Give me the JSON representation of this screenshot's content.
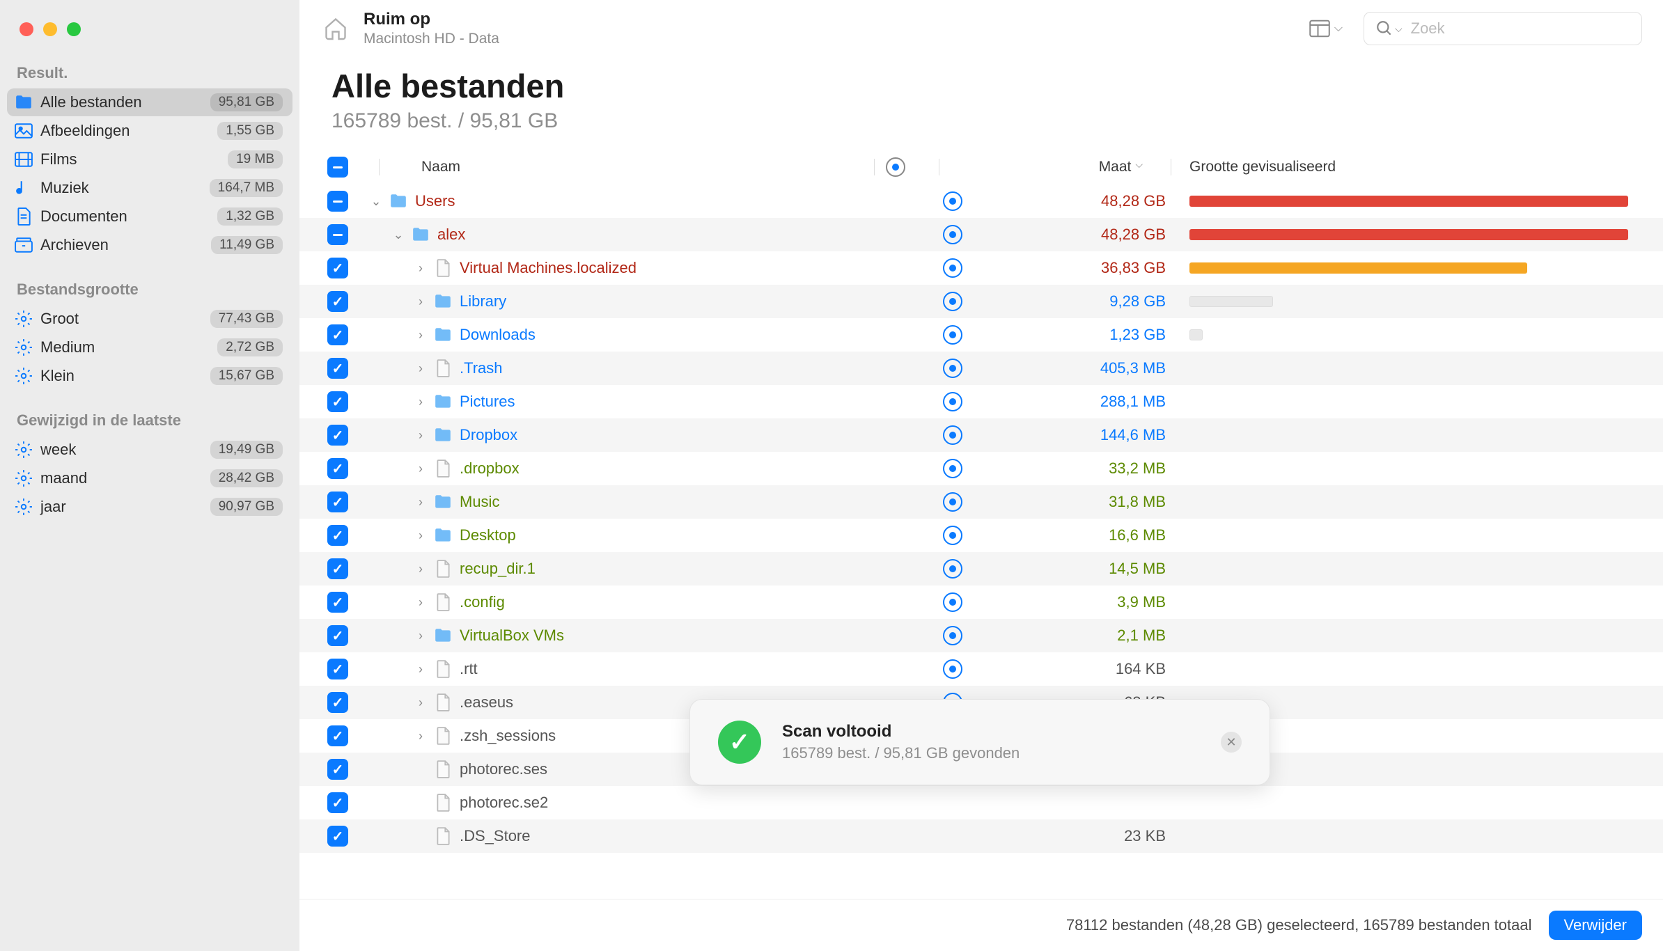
{
  "traffic": {
    "red": "#ff5f57",
    "yellow": "#febc2e",
    "green": "#28c840"
  },
  "topbar": {
    "title": "Ruim op",
    "subtitle": "Macintosh HD - Data",
    "search_placeholder": "Zoek"
  },
  "heading": {
    "title": "Alle bestanden",
    "subtitle": "165789 best. / 95,81 GB"
  },
  "columns": {
    "name": "Naam",
    "size": "Maat",
    "visual": "Grootte gevisualiseerd"
  },
  "sidebar": {
    "sections": [
      {
        "title": "Result.",
        "items": [
          {
            "icon": "folder",
            "color": "#0a7aff",
            "label": "Alle bestanden",
            "badge": "95,81 GB",
            "active": true
          },
          {
            "icon": "image",
            "color": "#0a7aff",
            "label": "Afbeeldingen",
            "badge": "1,55 GB"
          },
          {
            "icon": "film",
            "color": "#0a7aff",
            "label": "Films",
            "badge": "19 MB"
          },
          {
            "icon": "music",
            "color": "#0a7aff",
            "label": "Muziek",
            "badge": "164,7 MB"
          },
          {
            "icon": "doc",
            "color": "#0a7aff",
            "label": "Documenten",
            "badge": "1,32 GB"
          },
          {
            "icon": "archive",
            "color": "#0a7aff",
            "label": "Archieven",
            "badge": "11,49 GB"
          }
        ]
      },
      {
        "title": "Bestandsgrootte",
        "items": [
          {
            "icon": "gear",
            "color": "#0a7aff",
            "label": "Groot",
            "badge": "77,43 GB"
          },
          {
            "icon": "gear",
            "color": "#0a7aff",
            "label": "Medium",
            "badge": "2,72 GB"
          },
          {
            "icon": "gear",
            "color": "#0a7aff",
            "label": "Klein",
            "badge": "15,67 GB"
          }
        ]
      },
      {
        "title": "Gewijzigd in de laatste",
        "items": [
          {
            "icon": "gear",
            "color": "#0a7aff",
            "label": "week",
            "badge": "19,49 GB"
          },
          {
            "icon": "gear",
            "color": "#0a7aff",
            "label": "maand",
            "badge": "28,42 GB"
          },
          {
            "icon": "gear",
            "color": "#0a7aff",
            "label": "jaar",
            "badge": "90,97 GB"
          }
        ]
      }
    ]
  },
  "rows": [
    {
      "depth": 0,
      "chk": "partial",
      "expand": "down",
      "type": "folder",
      "name": "Users",
      "color": "#b22817",
      "target": true,
      "size": "48,28 GB",
      "sizeColor": "#b22817",
      "bar": 100,
      "barColor": "#e14438"
    },
    {
      "depth": 1,
      "chk": "partial",
      "expand": "down",
      "type": "folder",
      "name": "alex",
      "color": "#b22817",
      "target": true,
      "size": "48,28 GB",
      "sizeColor": "#b22817",
      "bar": 100,
      "barColor": "#e14438"
    },
    {
      "depth": 2,
      "chk": "checked",
      "expand": "right",
      "type": "file",
      "name": "Virtual Machines.localized",
      "color": "#b22817",
      "target": true,
      "size": "36,83 GB",
      "sizeColor": "#b22817",
      "bar": 77,
      "barColor": "#f5a623"
    },
    {
      "depth": 2,
      "chk": "checked",
      "expand": "right",
      "type": "folder",
      "name": "Library",
      "color": "#0a7aff",
      "target": true,
      "size": "9,28 GB",
      "sizeColor": "#0a7aff",
      "bar": 19,
      "barColor": "#e8e8e8",
      "barBorder": true
    },
    {
      "depth": 2,
      "chk": "checked",
      "expand": "right",
      "type": "folder",
      "name": "Downloads",
      "color": "#0a7aff",
      "target": true,
      "size": "1,23 GB",
      "sizeColor": "#0a7aff",
      "bar": 3,
      "barColor": "#e8e8e8",
      "barBorder": true
    },
    {
      "depth": 2,
      "chk": "checked",
      "expand": "right",
      "type": "file",
      "name": ".Trash",
      "color": "#0a7aff",
      "target": true,
      "size": "405,3 MB",
      "sizeColor": "#0a7aff"
    },
    {
      "depth": 2,
      "chk": "checked",
      "expand": "right",
      "type": "folder",
      "name": "Pictures",
      "color": "#0a7aff",
      "target": true,
      "size": "288,1 MB",
      "sizeColor": "#0a7aff"
    },
    {
      "depth": 2,
      "chk": "checked",
      "expand": "right",
      "type": "folder",
      "name": "Dropbox",
      "color": "#0a7aff",
      "target": true,
      "size": "144,6 MB",
      "sizeColor": "#0a7aff"
    },
    {
      "depth": 2,
      "chk": "checked",
      "expand": "right",
      "type": "file",
      "name": ".dropbox",
      "color": "#5c8a00",
      "target": true,
      "size": "33,2 MB",
      "sizeColor": "#5c8a00"
    },
    {
      "depth": 2,
      "chk": "checked",
      "expand": "right",
      "type": "folder",
      "name": "Music",
      "color": "#5c8a00",
      "target": true,
      "size": "31,8 MB",
      "sizeColor": "#5c8a00"
    },
    {
      "depth": 2,
      "chk": "checked",
      "expand": "right",
      "type": "folder",
      "name": "Desktop",
      "color": "#5c8a00",
      "target": true,
      "size": "16,6 MB",
      "sizeColor": "#5c8a00"
    },
    {
      "depth": 2,
      "chk": "checked",
      "expand": "right",
      "type": "file",
      "name": "recup_dir.1",
      "color": "#5c8a00",
      "target": true,
      "size": "14,5 MB",
      "sizeColor": "#5c8a00"
    },
    {
      "depth": 2,
      "chk": "checked",
      "expand": "right",
      "type": "file",
      "name": ".config",
      "color": "#5c8a00",
      "target": true,
      "size": "3,9 MB",
      "sizeColor": "#5c8a00"
    },
    {
      "depth": 2,
      "chk": "checked",
      "expand": "right",
      "type": "folder",
      "name": "VirtualBox VMs",
      "color": "#5c8a00",
      "target": true,
      "size": "2,1 MB",
      "sizeColor": "#5c8a00"
    },
    {
      "depth": 2,
      "chk": "checked",
      "expand": "right",
      "type": "file",
      "name": ".rtt",
      "color": "#555",
      "target": true,
      "size": "164 KB",
      "sizeColor": "#555"
    },
    {
      "depth": 2,
      "chk": "checked",
      "expand": "right",
      "type": "file",
      "name": ".easeus",
      "color": "#555",
      "target": true,
      "size": "68 KB",
      "sizeColor": "#555"
    },
    {
      "depth": 2,
      "chk": "checked",
      "expand": "right",
      "type": "file",
      "name": ".zsh_sessions",
      "color": "#555",
      "target": false,
      "size": "",
      "sizeColor": "#555"
    },
    {
      "depth": 2,
      "chk": "checked",
      "expand": "none",
      "type": "file",
      "name": "photorec.ses",
      "color": "#555",
      "target": false,
      "size": "",
      "sizeColor": "#555"
    },
    {
      "depth": 2,
      "chk": "checked",
      "expand": "none",
      "type": "file",
      "name": "photorec.se2",
      "color": "#555",
      "target": false,
      "size": "",
      "sizeColor": "#555"
    },
    {
      "depth": 2,
      "chk": "checked",
      "expand": "none",
      "type": "file",
      "name": ".DS_Store",
      "color": "#555",
      "target": false,
      "size": "23 KB",
      "sizeColor": "#555"
    }
  ],
  "bottom": {
    "status": "78112 bestanden (48,28 GB) geselecteerd, 165789 bestanden totaal",
    "delete": "Verwijder"
  },
  "toast": {
    "title": "Scan voltooid",
    "subtitle": "165789 best. / 95,81 GB gevonden"
  }
}
